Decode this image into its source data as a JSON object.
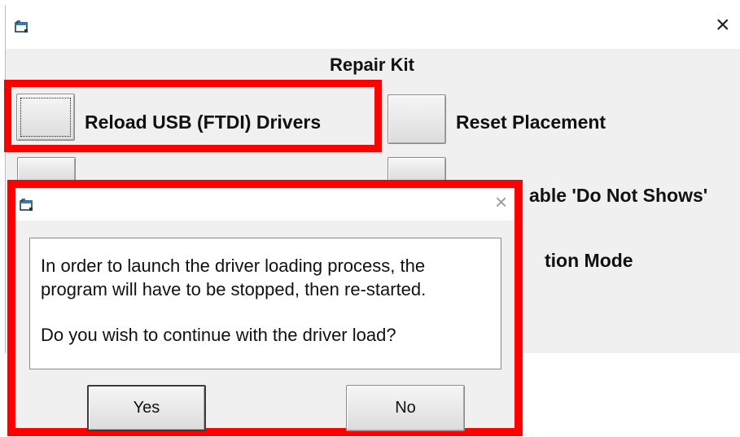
{
  "main_window": {
    "close_glyph": "×",
    "section_title": "Repair Kit",
    "buttons": [
      {
        "label": "Reload USB (FTDI) Drivers"
      },
      {
        "label": "Reset Placement"
      },
      {
        "label": "able 'Do Not Shows'"
      },
      {
        "label": "tion Mode"
      }
    ]
  },
  "dialog": {
    "close_glyph": "×",
    "message_lines": [
      "In order to launch the driver loading process, the",
      "program will have to be stopped, then re-started.",
      "Do you wish to continue with the driver load?"
    ],
    "yes_label": "Yes",
    "no_label": "No"
  },
  "colors": {
    "highlight": "#ff0000",
    "window_bg": "#f0f0f0",
    "titlebar": "#ffffff"
  },
  "icons": {
    "app": "app-window-icon",
    "close": "close-icon"
  }
}
